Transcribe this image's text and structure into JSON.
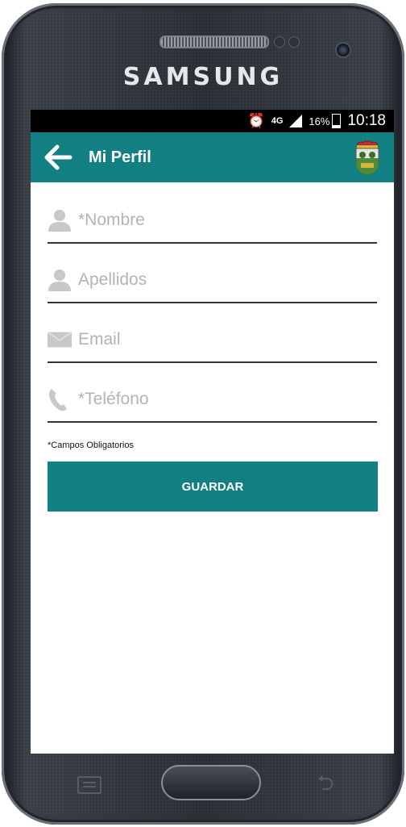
{
  "device": {
    "brand": "SAMSUNG"
  },
  "status_bar": {
    "alarm_icon": "alarm-clock-icon",
    "network": "4G",
    "battery_percent": "16%",
    "time": "10:18"
  },
  "app_bar": {
    "title": "Mi Perfil",
    "back_icon": "arrow-left-icon",
    "logo_icon": "municipal-crest-icon"
  },
  "form": {
    "fields": [
      {
        "name": "nombre",
        "placeholder": "*Nombre",
        "value": "",
        "icon": "person-icon"
      },
      {
        "name": "apellidos",
        "placeholder": "Apellidos",
        "value": "",
        "icon": "person-icon"
      },
      {
        "name": "email",
        "placeholder": "Email",
        "value": "",
        "icon": "envelope-icon"
      },
      {
        "name": "telefono",
        "placeholder": "*Teléfono",
        "value": "",
        "icon": "phone-icon"
      }
    ],
    "required_note": "*Campos Obligatorios",
    "save_label": "GUARDAR"
  },
  "colors": {
    "primary": "#127f82",
    "placeholder": "#b3b3b3",
    "icon": "#c8c8c8",
    "underline": "#333333"
  }
}
